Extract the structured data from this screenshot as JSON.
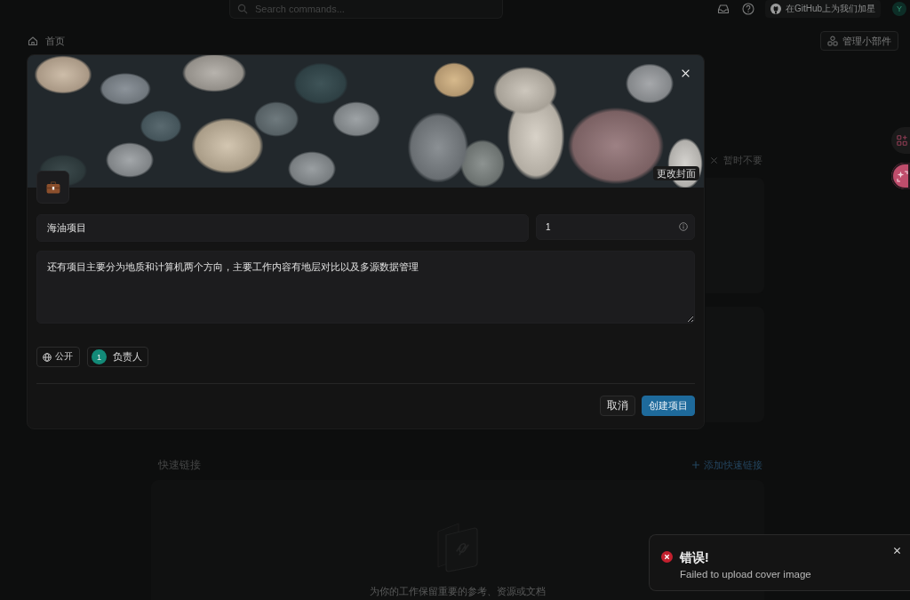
{
  "header": {
    "search": {
      "placeholder": "Search commands..."
    },
    "github_button": {
      "label": "在GitHub上为我们加星"
    },
    "avatar": {
      "initial": "Y"
    }
  },
  "breadcrumb": {
    "label": "首页"
  },
  "manage_widgets_button": {
    "label": "管理小部件"
  },
  "dismiss_button": {
    "label": "暂时不要"
  },
  "quick_links": {
    "title": "快速链接",
    "add_button": {
      "label": "添加快速链接"
    },
    "empty_text": "为你的工作保留重要的参考、资源或文档"
  },
  "modal": {
    "change_cover_button": {
      "label": "更改封面"
    },
    "name_field": {
      "value": "海油项目"
    },
    "number_field": {
      "value": "1"
    },
    "description_field": {
      "value": "还有项目主要分为地质和计算机两个方向，主要工作内容有地层对比以及多源数据管理"
    },
    "chips": [
      {
        "kind": "visibility",
        "label": "公开"
      },
      {
        "kind": "lead",
        "badge": "1",
        "label": "负责人"
      }
    ],
    "buttons": [
      {
        "kind": "secondary",
        "label": "取消"
      },
      {
        "kind": "primary",
        "label": "创建项目"
      }
    ]
  },
  "toast": {
    "kind": "error",
    "title": "错误!",
    "message": "Failed to upload cover image"
  }
}
